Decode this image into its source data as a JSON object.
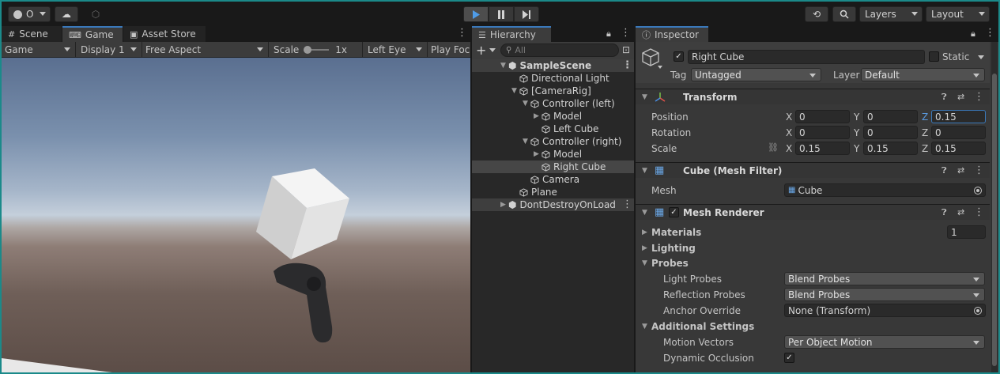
{
  "toolbar": {
    "account_label": "O",
    "layers_label": "Layers",
    "layout_label": "Layout"
  },
  "scene_panel": {
    "tabs": [
      {
        "label": "Scene"
      },
      {
        "label": "Game"
      },
      {
        "label": "Asset Store"
      }
    ],
    "game_bar": {
      "display_mode": "Game",
      "display": "Display 1",
      "aspect": "Free Aspect",
      "scale_label": "Scale",
      "scale_value": "1x",
      "eye": "Left Eye",
      "play_focused": "Play Foc"
    }
  },
  "hierarchy": {
    "tab_label": "Hierarchy",
    "search_placeholder": "All",
    "items": [
      {
        "label": "SampleScene"
      },
      {
        "label": "Directional Light"
      },
      {
        "label": "[CameraRig]"
      },
      {
        "label": "Controller (left)"
      },
      {
        "label": "Model"
      },
      {
        "label": "Left Cube"
      },
      {
        "label": "Controller (right)"
      },
      {
        "label": "Model"
      },
      {
        "label": "Right Cube"
      },
      {
        "label": "Camera"
      },
      {
        "label": "Plane"
      },
      {
        "label": "DontDestroyOnLoad"
      }
    ]
  },
  "inspector": {
    "tab_label": "Inspector",
    "object_name": "Right Cube",
    "static_label": "Static",
    "tag_label": "Tag",
    "tag_value": "Untagged",
    "layer_label": "Layer",
    "layer_value": "Default",
    "transform": {
      "title": "Transform",
      "position_label": "Position",
      "rotation_label": "Rotation",
      "scale_label": "Scale",
      "axis_x": "X",
      "axis_y": "Y",
      "axis_z": "Z",
      "position": {
        "x": "0",
        "y": "0",
        "z": "0.15"
      },
      "rotation": {
        "x": "0",
        "y": "0",
        "z": "0"
      },
      "scale": {
        "x": "0.15",
        "y": "0.15",
        "z": "0.15"
      }
    },
    "mesh_filter": {
      "title": "Cube (Mesh Filter)",
      "mesh_label": "Mesh",
      "mesh_value": "Cube"
    },
    "mesh_renderer": {
      "title": "Mesh Renderer",
      "materials_label": "Materials",
      "materials_count": "1",
      "lighting_label": "Lighting",
      "probes_label": "Probes",
      "light_probes_label": "Light Probes",
      "light_probes_value": "Blend Probes",
      "reflection_probes_label": "Reflection Probes",
      "reflection_probes_value": "Blend Probes",
      "anchor_override_label": "Anchor Override",
      "anchor_override_value": "None (Transform)",
      "additional_settings_label": "Additional Settings",
      "motion_vectors_label": "Motion Vectors",
      "motion_vectors_value": "Per Object Motion",
      "dynamic_occlusion_label": "Dynamic Occlusion"
    }
  },
  "colors": {
    "accent": "#3a79bb",
    "frame": "#1b8a8a"
  }
}
